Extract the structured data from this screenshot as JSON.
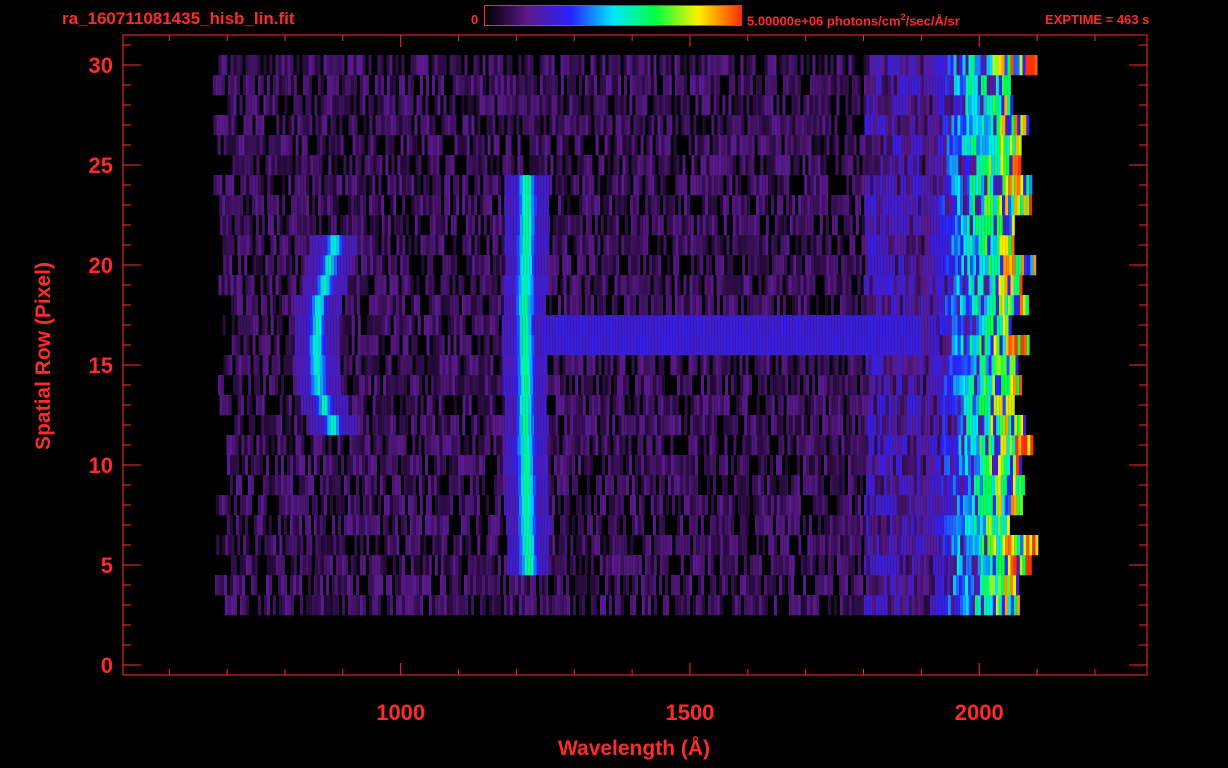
{
  "header": {
    "file_title": "ra_160711081435_hisb_lin.fit",
    "exptime": "EXPTIME = 463 s"
  },
  "colorbar": {
    "min_label": "0",
    "max_label_main": "5.00000e+06 photons/cm",
    "max_label_sup": "2",
    "max_label_tail": "/sec/Å/sr",
    "colormap": [
      "#000000",
      "#5a1a8a",
      "#2a20ff",
      "#00e6ff",
      "#00ff40",
      "#fff200",
      "#ff3000"
    ]
  },
  "colors": {
    "axis": "#ff2a2a",
    "background": "#000000"
  },
  "chart_data": {
    "type": "heatmap",
    "title": "ra_160711081435_hisb_lin.fit",
    "xlabel": "Wavelength (Å)",
    "ylabel": "Spatial Row (Pixel)",
    "xlim": [
      520,
      2290
    ],
    "ylim": [
      -0.5,
      31.5
    ],
    "x_ticks": [
      1000,
      1500,
      2000
    ],
    "x_tick_labels": [
      "1000",
      "1500",
      "2000"
    ],
    "y_ticks": [
      0,
      5,
      10,
      15,
      20,
      25,
      30
    ],
    "y_tick_labels": [
      "0",
      "5",
      "10",
      "15",
      "20",
      "25",
      "30"
    ],
    "data_region": {
      "x": [
        690,
        2100
      ],
      "rows": [
        3,
        30
      ]
    },
    "features": [
      {
        "name": "Lyman-alpha line",
        "x": [
          1218,
          1216,
          1214,
          1213,
          1212,
          1214,
          1216
        ],
        "rows": [
          5,
          8,
          11,
          14,
          17,
          20,
          24
        ],
        "peak_fraction": 0.6
      },
      {
        "name": "curved feature",
        "x": [
          880,
          865,
          855,
          852,
          855,
          866,
          882
        ],
        "rows": [
          12,
          13,
          14,
          16,
          18,
          19,
          21
        ],
        "peak_fraction": 0.55
      },
      {
        "name": "row 16 continuum",
        "x": [
          1240,
          1900
        ],
        "rows": [
          16,
          17
        ],
        "peak_fraction": 0.25
      },
      {
        "name": "red continuum edge",
        "x": [
          1900,
          2060
        ],
        "rows": [
          3,
          30
        ],
        "peak_fraction": 0.75
      }
    ]
  }
}
